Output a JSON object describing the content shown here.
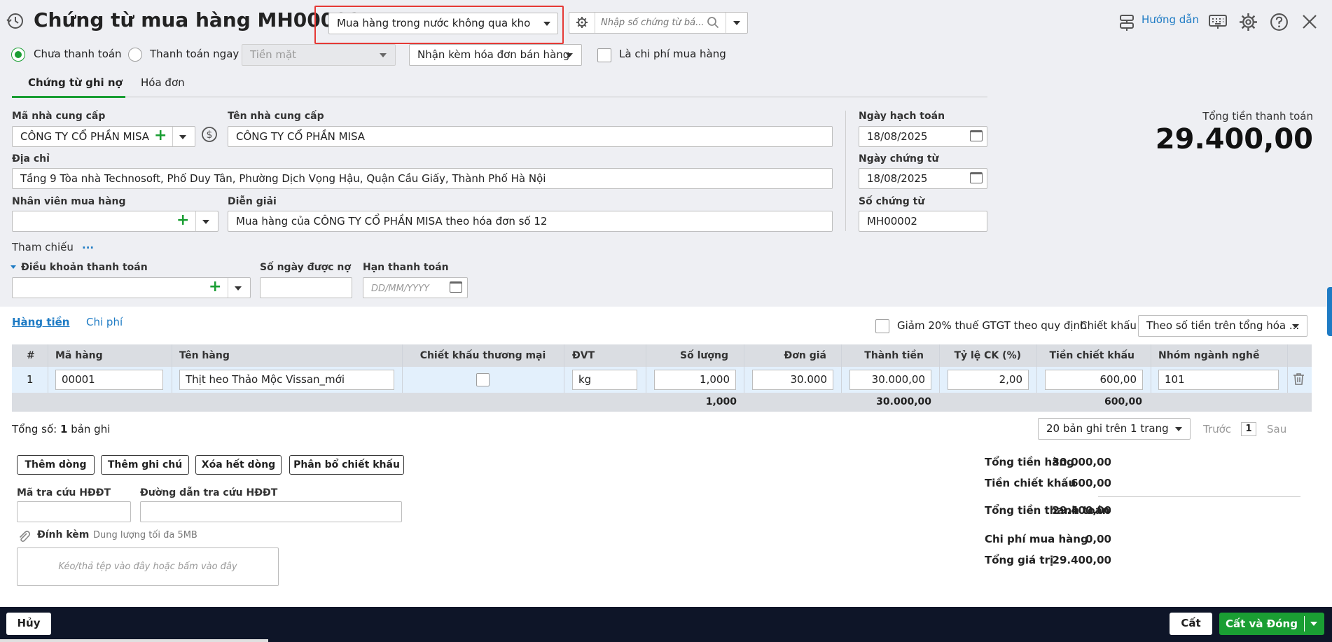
{
  "header": {
    "title": "Chứng từ mua hàng MH00002",
    "purchase_type": "Mua hàng trong nước không qua kho",
    "search_placeholder": "Nhập số chứng từ bá...",
    "guide_label": "Hướng dẫn"
  },
  "payment": {
    "unpaid_label": "Chưa thanh toán",
    "pay_now_label": "Thanh toán ngay",
    "method": "Tiền mặt",
    "invoice_option": "Nhận kèm hóa đơn bán hàng",
    "purchase_cost_label": "Là chi phí mua hàng"
  },
  "tabs": {
    "debit_voucher": "Chứng từ ghi nợ",
    "invoice": "Hóa đơn"
  },
  "form": {
    "supplier_code_label": "Mã nhà cung cấp",
    "supplier_code": "CÔNG TY CỔ PHẦN MISA",
    "supplier_name_label": "Tên nhà cung cấp",
    "supplier_name": "CÔNG TY CỔ PHẦN MISA",
    "address_label": "Địa chỉ",
    "address": "Tầng 9 Tòa nhà Technosoft, Phố Duy Tân, Phường Dịch Vọng Hậu, Quận Cầu Giấy, Thành Phố Hà Nội",
    "employee_label": "Nhân viên mua hàng",
    "employee": "",
    "description_label": "Diễn giải",
    "description": "Mua hàng của CÔNG TY CỔ PHẦN MISA theo hóa đơn số 12",
    "reference_label": "Tham chiếu",
    "reference_more": "...",
    "payment_terms_label": "Điều khoản thanh toán",
    "payment_terms": "",
    "credit_days_label": "Số ngày được nợ",
    "credit_days": "",
    "due_date_label": "Hạn thanh toán",
    "due_date_placeholder": "DD/MM/YYYY",
    "posting_date_label": "Ngày hạch toán",
    "posting_date": "18/08/2025",
    "voucher_date_label": "Ngày chứng từ",
    "voucher_date": "18/08/2025",
    "voucher_no_label": "Số chứng từ",
    "voucher_no": "MH00002"
  },
  "total_box": {
    "label": "Tổng tiền thanh toán",
    "value": "29.400,00"
  },
  "detail_tabs": {
    "goods": "Hàng tiền",
    "cost": "Chi phí"
  },
  "vat_reduction_label": "Giảm 20% thuế GTGT theo quy định",
  "discount_label": "Chiết khấu",
  "discount_option": "Theo số tiền trên tổng hóa ...",
  "table": {
    "headers": {
      "no": "#",
      "code": "Mã hàng",
      "name": "Tên hàng",
      "trade_discount": "Chiết khấu thương mại",
      "unit": "ĐVT",
      "qty": "Số lượng",
      "price": "Đơn giá",
      "amount": "Thành tiền",
      "rate": "Tỷ lệ CK (%)",
      "discount_amount": "Tiền chiết khấu",
      "industry": "Nhóm ngành nghề"
    },
    "rows": [
      {
        "no": "1",
        "code": "00001",
        "name": "Thịt heo Thảo Mộc Vissan_mới",
        "unit": "kg",
        "qty": "1,000",
        "price": "30.000",
        "amount": "30.000,00",
        "rate": "2,00",
        "discount_amount": "600,00",
        "industry": "101"
      }
    ],
    "footer": {
      "qty": "1,000",
      "amount": "30.000,00",
      "discount_amount": "600,00"
    }
  },
  "pagination": {
    "total_prefix": "Tổng số:",
    "total_count": "1",
    "total_suffix": "bản ghi",
    "per_page": "20 bản ghi trên 1 trang",
    "prev": "Trước",
    "page": "1",
    "next": "Sau"
  },
  "actions": {
    "add_row": "Thêm dòng",
    "add_note": "Thêm ghi chú",
    "delete_all": "Xóa hết dòng",
    "allocate_discount": "Phân bổ chiết khấu"
  },
  "einvoice": {
    "lookup_code_label": "Mã tra cứu HĐĐT",
    "lookup_url_label": "Đường dẫn tra cứu HĐĐT"
  },
  "attachment": {
    "label": "Đính kèm",
    "limit": "Dung lượng tối đa 5MB",
    "drop_hint": "Kéo/thả tệp vào đây hoặc bấm vào đây"
  },
  "summary": {
    "goods_total_label": "Tổng tiền hàng",
    "goods_total": "30.000,00",
    "discount_label": "Tiền chiết khấu",
    "discount": "600,00",
    "payment_total_label": "Tổng tiền thanh toán",
    "payment_total": "29.400,00",
    "purchase_cost_label": "Chi phí mua hàng",
    "purchase_cost": "0,00",
    "total_value_label": "Tổng giá trị",
    "total_value": "29.400,00"
  },
  "footer": {
    "cancel": "Hủy",
    "save": "Cất",
    "save_close": "Cất và Đóng"
  },
  "colors": {
    "accent": "#1a9e33",
    "link": "#1e7bc4",
    "footer_bg": "#0e1528",
    "highlight": "#e53935"
  }
}
